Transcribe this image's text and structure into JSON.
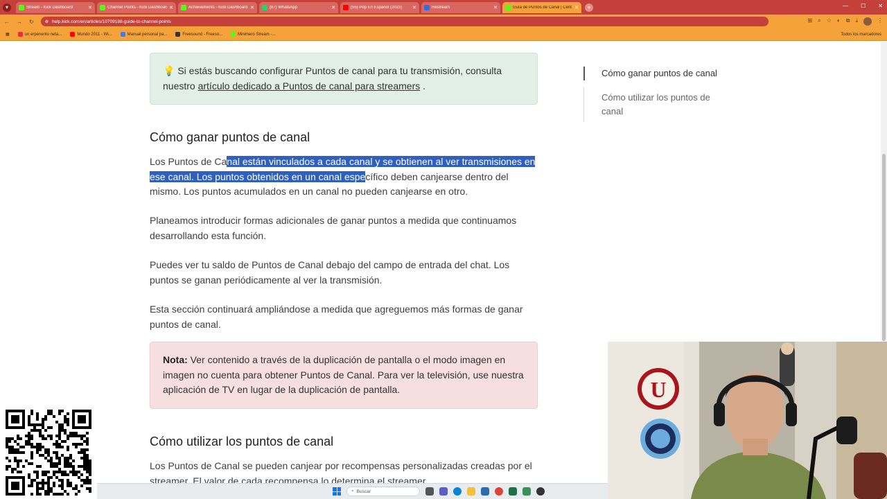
{
  "browser": {
    "tabs": [
      {
        "label": "Stream - Kick Dashboard",
        "favicon_color": "#53fc18",
        "active": false
      },
      {
        "label": "Channel Points - Kick Dashboard",
        "favicon_color": "#53fc18",
        "active": false
      },
      {
        "label": "Achievements - Kick Dashboard",
        "favicon_color": "#53fc18",
        "active": false
      },
      {
        "label": "(87) WhatsApp",
        "favicon_color": "#25d366",
        "active": false
      },
      {
        "label": "(55) Pop En Español (2023)",
        "favicon_color": "#ff0000",
        "active": false
      },
      {
        "label": "Restream",
        "favicon_color": "#2f6fe0",
        "active": false
      },
      {
        "label": "Guía de Puntos de Canal | Cent",
        "favicon_color": "#53fc18",
        "active": true
      }
    ],
    "url": "help.kick.com/en/articles/10709188-guide-to-channel-points",
    "bookmarks": [
      {
        "label": "un erpenento neta...",
        "color": "#e83030"
      },
      {
        "label": "Mundo 2011 - Wi...",
        "color": "#ff0000"
      },
      {
        "label": "Manual personal pa...",
        "color": "#4a7bd0"
      },
      {
        "label": "Freesound - Freeso...",
        "color": "#333333"
      },
      {
        "label": "Minimero Stream -...",
        "color": "#53fc18"
      }
    ],
    "all_bookmarks_label": "Todos los marcadores"
  },
  "article": {
    "callout": {
      "icon": "lightbulb-icon",
      "text_before": "Si estás buscando configurar Puntos de canal para tu transmisión, consulta nuestro ",
      "link": "artículo dedicado a Puntos de canal para streamers",
      "text_after": " ."
    },
    "section1_heading": "Cómo ganar puntos de canal",
    "p1_before": "Los Puntos de Ca",
    "p1_selected": "nal están vinculados a cada canal y se obtienen al ver transmisiones en ese canal. Los puntos obtenidos en un canal espe",
    "p1_after": "cífico deben canjearse dentro del mismo. Los puntos acumulados en un canal no pueden canjearse en otro.",
    "p2": "Planeamos introducir formas adicionales de ganar puntos a medida que continuamos desarrollando esta función.",
    "p3": "Puedes ver tu saldo de Puntos de Canal debajo del campo de entrada del chat. Los puntos se ganan periódicamente al ver la transmisión.",
    "p4": "Esta sección continuará ampliándose a medida que agreguemos más formas de ganar puntos de canal.",
    "note_label": "Nota:",
    "note_text": " Ver contenido a través de la duplicación de pantalla o el modo imagen en imagen no cuenta para obtener Puntos de Canal. Para ver la televisión, use nuestra aplicación de TV en lugar de la duplicación de pantalla.",
    "section2_heading": "Cómo utilizar los puntos de canal",
    "p5": "Los Puntos de Canal se pueden canjear por recompensas personalizadas creadas por el streamer. El valor de cada recompensa lo determina el streamer."
  },
  "toc": {
    "items": [
      "Cómo ganar puntos de canal",
      "Cómo utilizar los puntos de canal"
    ]
  },
  "taskbar": {
    "search_placeholder": "Buscar"
  },
  "colors": {
    "tab_bar": "#c4403a",
    "toolbar": "#f6a23a",
    "selection": "#2f5fbf",
    "callout_bg": "#e3f0e7",
    "note_bg": "#f7dfe1"
  }
}
